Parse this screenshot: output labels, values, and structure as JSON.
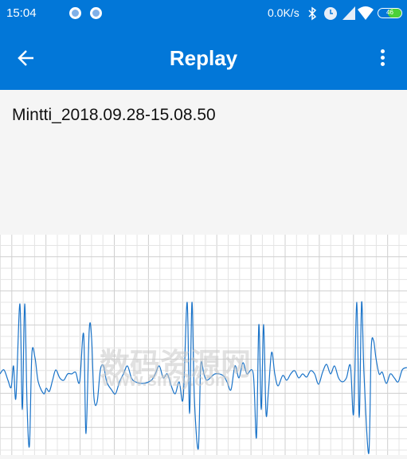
{
  "status_bar": {
    "time": "15:04",
    "network_speed": "0.0K/s",
    "battery": "46",
    "icons": [
      "notification-dot-icon",
      "notification-dot-icon",
      "bluetooth-icon",
      "alarm-icon",
      "signal-icon",
      "wifi-icon",
      "battery-icon"
    ]
  },
  "app_bar": {
    "title": "Replay",
    "back_icon": "arrow-left-icon",
    "menu_icon": "more-vert-icon",
    "color": "#0277d8"
  },
  "recording": {
    "file_name": "Mintti_2018.09.28-15.08.50"
  },
  "waveform": {
    "line_color": "#1a73c8",
    "grid_color": "#d9d9d9"
  },
  "watermark": {
    "text": "数码资源网",
    "url": "www.smzy.com"
  }
}
